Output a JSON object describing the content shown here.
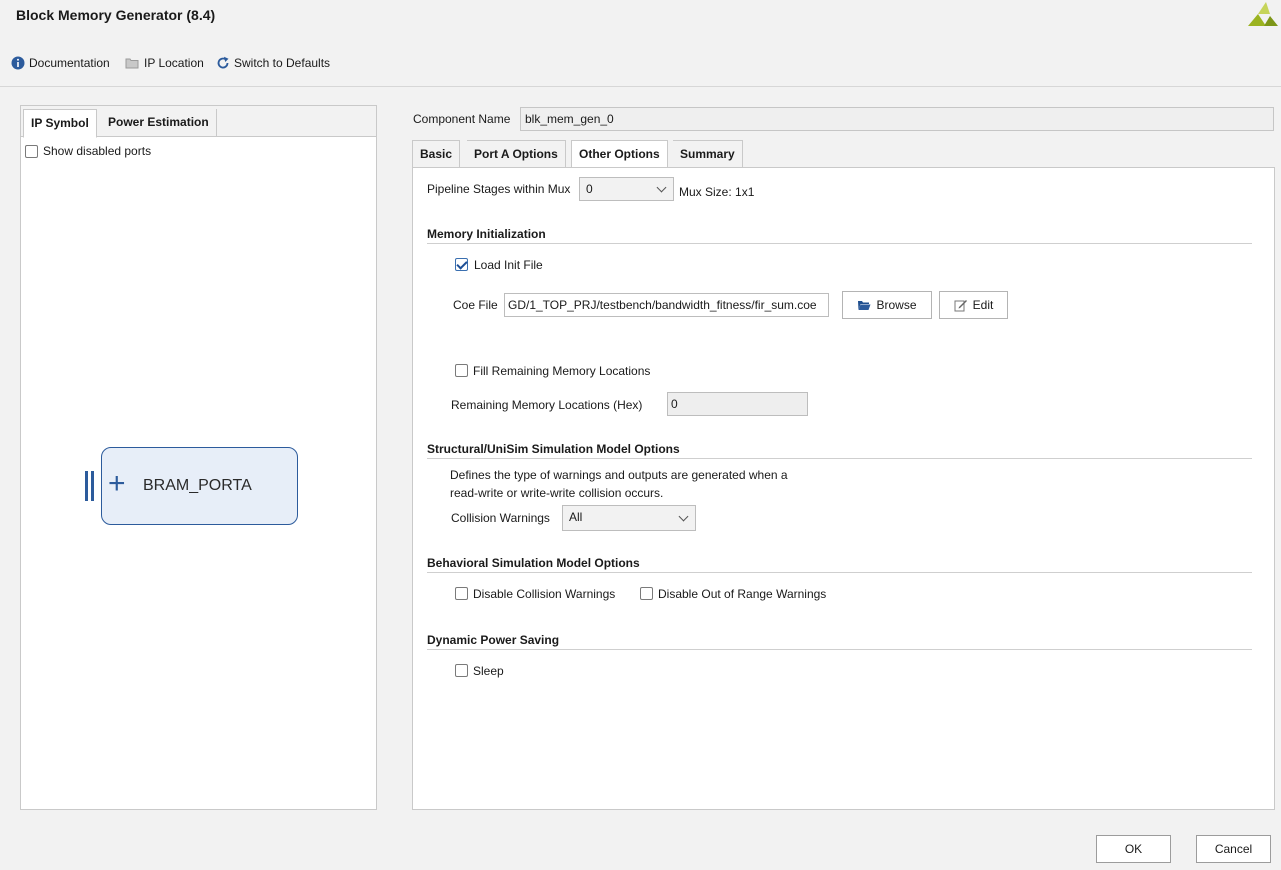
{
  "window": {
    "title": "Block Memory Generator (8.4)"
  },
  "toolbar": {
    "documentation": "Documentation",
    "ip_location": "IP Location",
    "switch_defaults": "Switch to Defaults"
  },
  "left_tabs": [
    "IP Symbol",
    "Power Estimation"
  ],
  "left": {
    "show_disabled_ports": "Show disabled ports",
    "show_disabled_checked": false,
    "bram_label": "BRAM_PORTA"
  },
  "component": {
    "label": "Component Name",
    "value": "blk_mem_gen_0"
  },
  "tabs": [
    "Basic",
    "Port A Options",
    "Other Options",
    "Summary"
  ],
  "active_tab": "Other Options",
  "other": {
    "pipeline_label": "Pipeline Stages within Mux",
    "pipeline_value": "0",
    "mux_size": "Mux Size: 1x1",
    "mem_init_title": "Memory Initialization",
    "load_init_label": "Load Init File",
    "load_init_checked": true,
    "coe_label": "Coe File",
    "coe_value": "GD/1_TOP_PRJ/testbench/bandwidth_fitness/fir_sum.coe",
    "browse_label": "Browse",
    "edit_label": "Edit",
    "fill_label": "Fill Remaining Memory Locations",
    "fill_checked": false,
    "remaining_label": "Remaining Memory Locations (Hex)",
    "remaining_value": "0",
    "structural_title": "Structural/UniSim Simulation Model Options",
    "structural_desc_1": "Defines the type of warnings and outputs are generated when a",
    "structural_desc_2": "read-write or write-write collision occurs.",
    "collision_label": "Collision Warnings",
    "collision_value": "All",
    "behavioral_title": "Behavioral Simulation Model Options",
    "disable_collision_label": "Disable Collision Warnings",
    "disable_collision_checked": false,
    "disable_range_label": "Disable Out of Range Warnings",
    "disable_range_checked": false,
    "power_title": "Dynamic Power Saving",
    "sleep_label": "Sleep",
    "sleep_checked": false
  },
  "buttons": {
    "ok": "OK",
    "cancel": "Cancel"
  },
  "colors": {
    "accent": "#2c5b9c",
    "logo": "#9bb320"
  }
}
